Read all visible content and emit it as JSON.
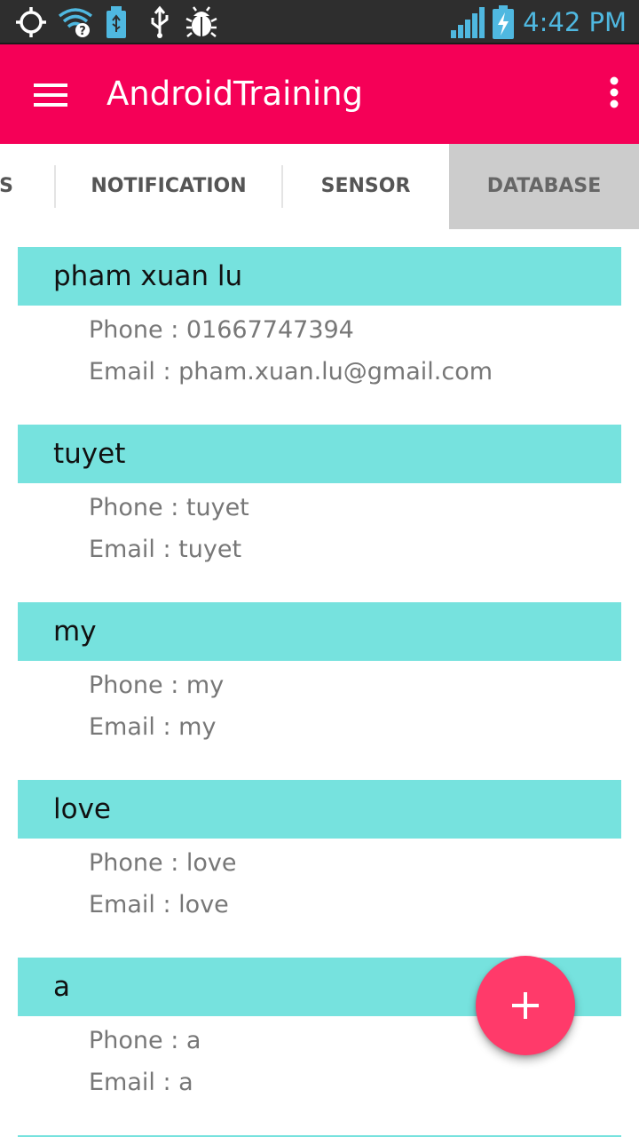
{
  "status_bar": {
    "time": "4:42 PM",
    "time_color": "#4fb8e0",
    "icons": [
      "gps-icon",
      "wifi-unknown-icon",
      "usb-storage-icon",
      "usb-icon",
      "debug-bug-icon",
      "signal-icon",
      "battery-charging-icon"
    ]
  },
  "app_bar": {
    "title": "AndroidTraining",
    "color": "#f50057",
    "left_icon": "menu-icon",
    "right_icon": "overflow-menu-icon"
  },
  "tabs": [
    {
      "label": "S",
      "selected": false
    },
    {
      "label": "NOTIFICATION",
      "selected": false
    },
    {
      "label": "SENSOR",
      "selected": false
    },
    {
      "label": "DATABASE",
      "selected": true
    }
  ],
  "contacts": [
    {
      "name": "pham xuan lu",
      "phone": "Phone : 01667747394",
      "email": "Email : pham.xuan.lu@gmail.com"
    },
    {
      "name": "tuyet",
      "phone": "Phone : tuyet",
      "email": "Email : tuyet"
    },
    {
      "name": "my",
      "phone": "Phone : my",
      "email": "Email : my"
    },
    {
      "name": "love",
      "phone": "Phone : love",
      "email": "Email : love"
    },
    {
      "name": "a",
      "phone": "Phone : a",
      "email": "Email : a"
    }
  ],
  "contact_bar_color": "#76e2de",
  "fab": {
    "icon": "add-icon",
    "color": "#ff3a6a"
  }
}
